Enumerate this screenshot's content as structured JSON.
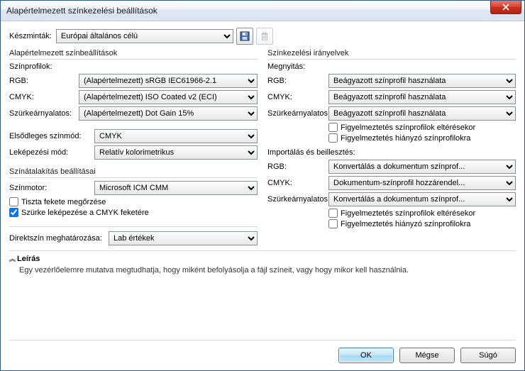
{
  "window": {
    "title": "Alapértelmezett színkezelési beállítások"
  },
  "preset": {
    "label": "Készminták:",
    "value": "Európai általános célú"
  },
  "left": {
    "group1_title": "Alapértelmezett színbeállítások",
    "profiles_head": "Színprofilok:",
    "rgb_label": "RGB:",
    "rgb_value": "(Alapértelmezett) sRGB IEC61966-2.1",
    "cmyk_label": "CMYK:",
    "cmyk_value": "(Alapértelmezett) ISO Coated v2 (ECI)",
    "gray_label": "Szürkeárnyalatos:",
    "gray_value": "(Alapértelmezett) Dot Gain 15%",
    "primary_mode_label": "Elsődleges színmód:",
    "primary_mode_value": "CMYK",
    "render_label": "Leképezési mód:",
    "render_value": "Relatív kolorimetrikus",
    "group2_title": "Színátalakítás beállításai",
    "engine_label": "Színmotor:",
    "engine_value": "Microsoft ICM CMM",
    "chk_pureblack": "Tiszta fekete megőrzése",
    "chk_mapgray": "Szürke leképezése a CMYK feketére",
    "spot_label": "Direktszín meghatározása:",
    "spot_value": "Lab értékek"
  },
  "right": {
    "group_title": "Színkezelési irányelvek",
    "open_head": "Megnyitás:",
    "rgb_label": "RGB:",
    "cmyk_label": "CMYK:",
    "gray_label": "Szürkeárnyalatos:",
    "open_rgb": "Beágyazott színprofil használata",
    "open_cmyk": "Beágyazott színprofil használata",
    "open_gray": "Beágyazott színprofil használata",
    "chk_warn_mismatch": "Figyelmeztetés színprofilok eltérésekor",
    "chk_warn_missing": "Figyelmeztetés hiányzó színprofilokra",
    "import_head": "Importálás és beillesztés:",
    "imp_rgb": "Konvertálás a dokumentum színprof...",
    "imp_cmyk": "Dokumentum-színprofil hozzárendel...",
    "imp_gray": "Konvertálás a dokumentum színprof..."
  },
  "desc": {
    "title": "Leírás",
    "text": "Egy vezérlőelemre mutatva megtudhatja, hogy miként befolyásolja a fájl színeit, vagy hogy mikor kell használnia."
  },
  "buttons": {
    "ok": "OK",
    "cancel": "Mégse",
    "help": "Súgó"
  }
}
